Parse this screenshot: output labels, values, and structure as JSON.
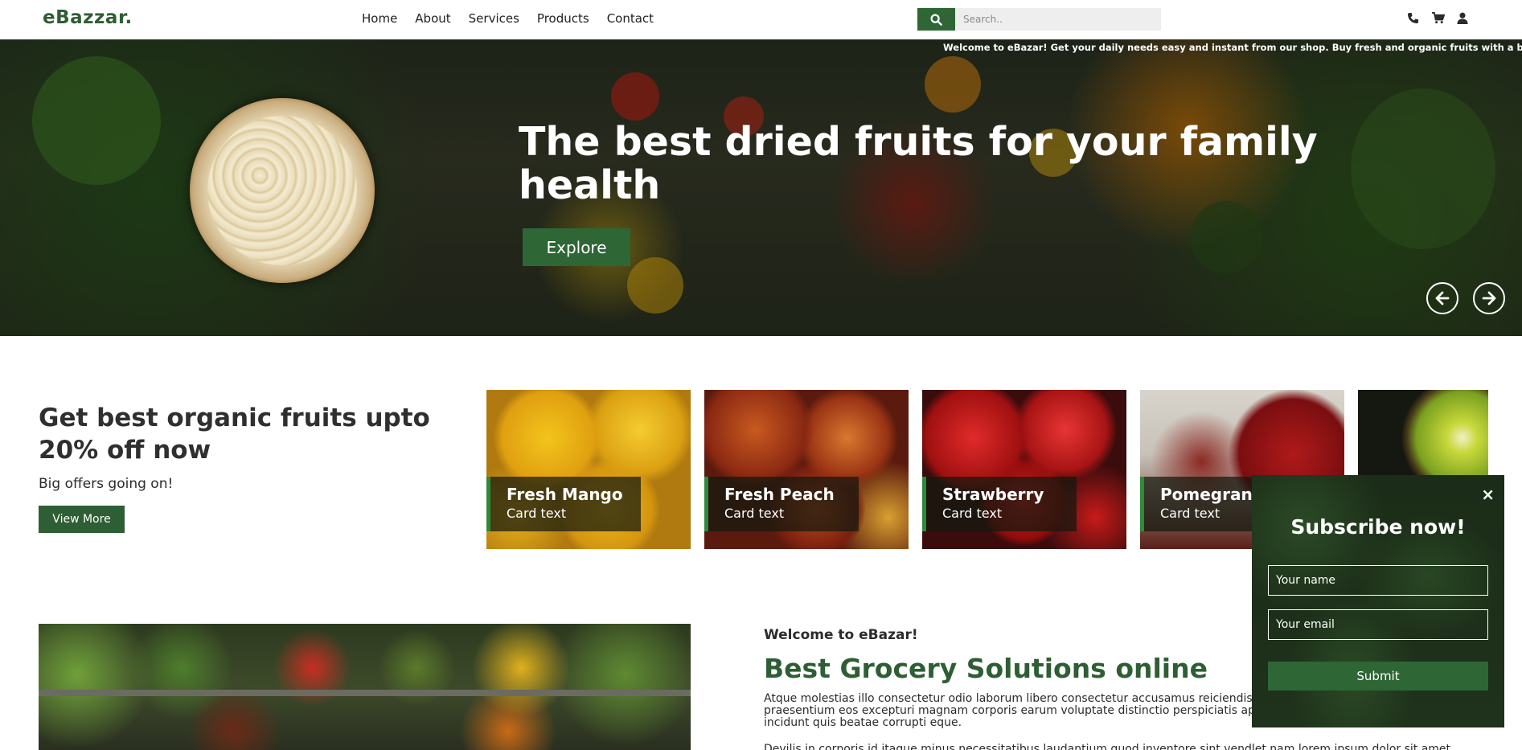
{
  "header": {
    "brand": "eBazzar.",
    "nav": [
      "Home",
      "About",
      "Services",
      "Products",
      "Contact"
    ],
    "search_placeholder": "Search..",
    "icons": [
      "search-icon",
      "phone-icon",
      "cart-icon",
      "user-icon"
    ]
  },
  "hero": {
    "marquee": "Welcome to eBazar! Get your daily needs easy and instant from our shop. Buy fresh and organic fruits with a big discou",
    "title": "The best dried fruits for your family health",
    "cta": "Explore"
  },
  "offer": {
    "title": "Get best organic fruits upto 20% off now",
    "subtitle": "Big offers going on!",
    "button": "View More",
    "cards": [
      {
        "title": "Fresh Mango",
        "text": "Card text"
      },
      {
        "title": "Fresh Peach",
        "text": "Card text"
      },
      {
        "title": "Strawberry",
        "text": "Card text"
      },
      {
        "title": "Pomegrana",
        "text": "Card text"
      }
    ]
  },
  "about": {
    "kicker": "Welcome to eBazar!",
    "title": "Best Grocery Solutions online",
    "text": "Atque molestias illo consectetur odio laborum libero consectetur accusamus reiciendis cupiditate fugit iusto perferendis praesentium eos excepturi magnam corporis earum voluptate distinctio perspiciatis aperiam rerum quae soluta quam incidunt quis beatae corrupti eque.",
    "text2": "Devilis in corporis id itaque minus necessitatibus laudantium quod inventore sint vendlet nam lorem ipsum dolor sit amet"
  },
  "subscribe": {
    "title": "Subscribe now!",
    "name_placeholder": "Your name",
    "email_placeholder": "Your email",
    "submit": "Submit",
    "close": "×"
  },
  "colors": {
    "brand_green": "#2e5e34",
    "button_green": "#2e6636"
  }
}
